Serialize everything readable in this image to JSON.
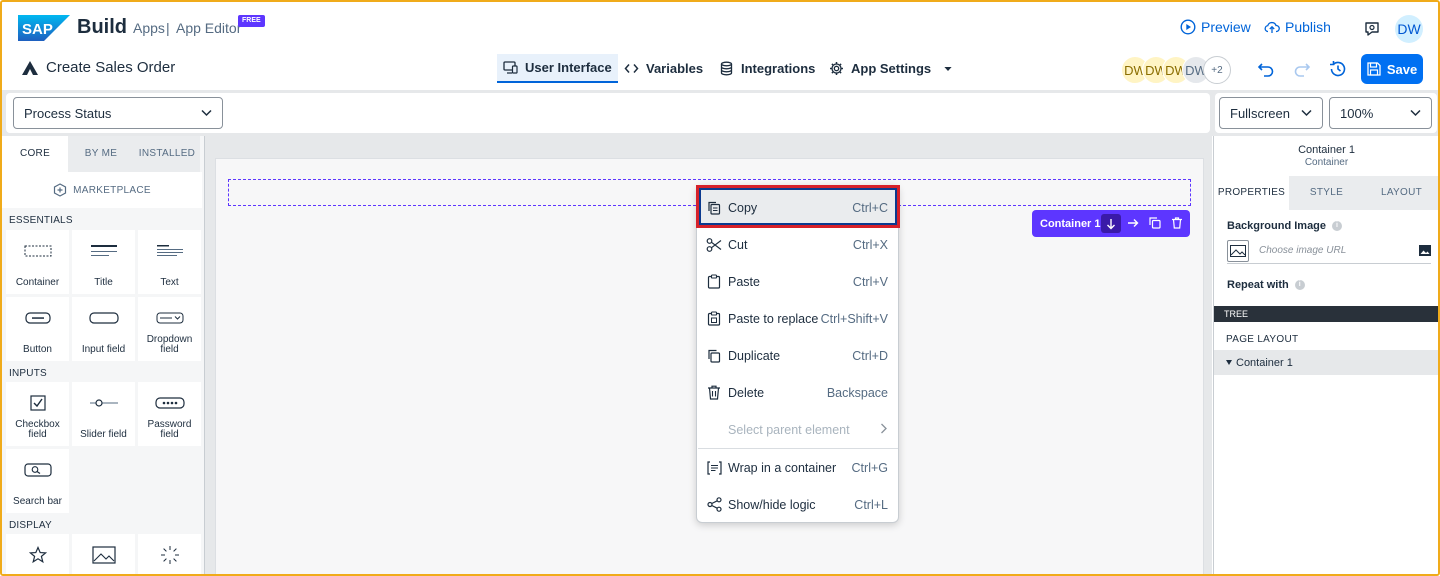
{
  "header": {
    "brand_logo_text": "SAP",
    "brand": "Build",
    "crumb_apps": "Apps",
    "crumb_separator": "|",
    "crumb_editor": "App Editor",
    "free_badge": "FREE",
    "preview": "Preview",
    "publish": "Publish",
    "user_initials": "DW",
    "app_name": "Create Sales Order",
    "tabs": [
      {
        "label": "User Interface",
        "icon": "monitor-icon",
        "active": true
      },
      {
        "label": "Variables",
        "icon": "code-icon",
        "active": false
      },
      {
        "label": "Integrations",
        "icon": "database-icon",
        "active": false
      },
      {
        "label": "App Settings",
        "icon": "gear-icon",
        "active": false
      }
    ],
    "collaborators": [
      "DW",
      "DW",
      "DW",
      "DW"
    ],
    "collaborators_more": "+2",
    "save": "Save"
  },
  "toolbar": {
    "page_select": "Process Status",
    "view_select": "Fullscreen",
    "zoom_select": "100%"
  },
  "left_panel": {
    "tabs": [
      "CORE",
      "BY ME",
      "INSTALLED"
    ],
    "active_tab": "CORE",
    "marketplace": "MARKETPLACE",
    "sections": {
      "essentials": "ESSENTIALS",
      "inputs": "INPUTS",
      "display": "DISPLAY"
    },
    "components": {
      "container": "Container",
      "title": "Title",
      "text": "Text",
      "button": "Button",
      "input_field": "Input field",
      "dropdown_field": "Dropdown field",
      "checkbox_field": "Checkbox field",
      "slider_field": "Slider field",
      "password_field": "Password field",
      "search_bar": "Search bar"
    }
  },
  "canvas": {
    "selected_label": "Container 1"
  },
  "context_menu": {
    "items": [
      {
        "label": "Copy",
        "shortcut": "Ctrl+C",
        "icon": "copy-icon"
      },
      {
        "label": "Cut",
        "shortcut": "Ctrl+X",
        "icon": "scissors-icon"
      },
      {
        "label": "Paste",
        "shortcut": "Ctrl+V",
        "icon": "paste-icon"
      },
      {
        "label": "Paste to replace",
        "shortcut": "Ctrl+Shift+V",
        "icon": "paste-replace-icon"
      },
      {
        "label": "Duplicate",
        "shortcut": "Ctrl+D",
        "icon": "duplicate-icon"
      },
      {
        "label": "Delete",
        "shortcut": "Backspace",
        "icon": "trash-icon"
      },
      {
        "label": "Select parent element",
        "shortcut": "",
        "icon": "chevron-right-icon",
        "disabled": true
      },
      {
        "label": "Wrap in a container",
        "shortcut": "Ctrl+G",
        "icon": "wrap-icon"
      },
      {
        "label": "Show/hide logic",
        "shortcut": "Ctrl+L",
        "icon": "share-icon"
      }
    ]
  },
  "right_panel": {
    "title": "Container 1",
    "subtitle": "Container",
    "tabs": [
      "PROPERTIES",
      "STYLE",
      "LAYOUT"
    ],
    "active_tab": "PROPERTIES",
    "background_image_label": "Background Image",
    "image_url_placeholder": "Choose image URL",
    "repeat_with_label": "Repeat with",
    "tree_label": "TREE",
    "page_layout_label": "PAGE LAYOUT",
    "tree_root": "Container 1"
  },
  "colors": {
    "accent": "#0070f2",
    "selection": "#5d36ff",
    "highlight_outline": "#d6212a",
    "frame": "#f0ab1a"
  }
}
